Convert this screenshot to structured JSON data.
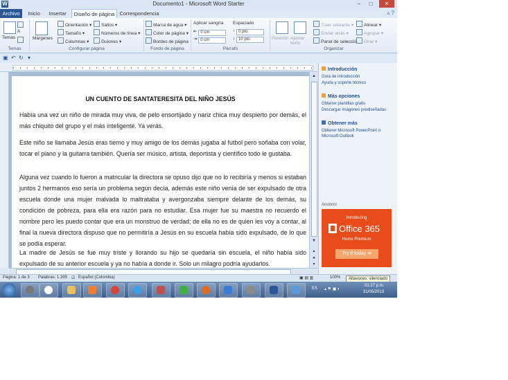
{
  "window": {
    "title": "Documento1 - Microsoft Word Starter",
    "app_icon": "W"
  },
  "tabs": [
    {
      "label": "Archivo"
    },
    {
      "label": "Inicio"
    },
    {
      "label": "Insertar"
    },
    {
      "label": "Diseño de página"
    },
    {
      "label": "Correspondencia"
    }
  ],
  "ribbon": {
    "temas": {
      "label": "Temas",
      "group": "Temas"
    },
    "configurar": {
      "margenes": "Márgenes",
      "orientacion": "Orientación",
      "tamano": "Tamaño",
      "columnas": "Columnas",
      "saltos": "Saltos",
      "numeros_linea": "Números de línea",
      "guiones": "Guiones",
      "group": "Configurar página"
    },
    "fondo": {
      "marca_agua": "Marca de agua",
      "color_pagina": "Color de página",
      "bordes_pagina": "Bordes de página",
      "group": "Fondo de página"
    },
    "parrafo": {
      "aplicar_sangria": "Aplicar sangría",
      "espaciado": "Espaciado",
      "izq": "0 cm",
      "der": "0 cm",
      "antes": "0 pto",
      "despues": "10 pto",
      "group": "Párrafo"
    },
    "organizar": {
      "posicion": "Posición",
      "ajustar_texto": "Ajustar texto",
      "traer_adelante": "Traer adelante",
      "enviar_atras": "Enviar atrás",
      "panel_seleccion": "Panel de selección",
      "alinear": "Alinear",
      "agrupar": "Agrupar",
      "girar": "Girar",
      "group": "Organizar"
    }
  },
  "document": {
    "title": "UN CUENTO DE SANTATERESITA DEL NIÑO JESÚS",
    "paragraphs": [
      "Había una vez un niño de mirada muy viva, de pelo ensortijado y nariz chica muy despierto por demás, el más chiquito del grupo y el más inteligente. Ya verás.",
      "Este niño se llamaba Jesús eras tierno y muy amigo de los demás jugaba al futbol pero soñaba con volar, tocar el piano y la guitarra también. Quería ser músico, artista, deportista y científico todo le gustaba.",
      "Alguna vez cuando lo fueron a matricular la directora se opuso dijo que no lo recibiría y menos si estaban juntos 2 hermanos eso sería un problema según decía, además este niño venía de ser expulsado de otra escuela donde una mujer malvada lo maltrataba y avergonzaba siempre delante de los demás, su condición de pobreza, para ella era razón para no estudiar. Esa mujer fue su maestra no recuerdo el nombre pero les puedo contar que era un monstruo de verdad; de ella no es de quien les voy a contar, al final la nueva directora dispuso que no permitiría a Jesús en su escuela había sido expulsado, de lo que se podía esperar.",
      "La madre de Jesús se fue muy triste y llorando su hijo se quedaría sin escuela, el niño había sido expulsado de su anterior escuela y ya no había a donde ir. Solo un milagro podría ayudarlos."
    ]
  },
  "task_pane": {
    "sections": [
      {
        "title": "Introducción",
        "links": [
          "Guía de introducción",
          "Ayuda y soporte técnico"
        ]
      },
      {
        "title": "Más opciones",
        "links": [
          "Obtener plantillas gratis",
          "Descargar imágenes prediseñadas"
        ]
      },
      {
        "title": "Obtener más",
        "links": [
          "Obtener Microsoft PowerPoint o",
          "Microsoft Outlook"
        ]
      }
    ],
    "ad_label": "Anuncio",
    "ad": {
      "intro": "Introducing",
      "product": "Office 365",
      "edition": "Home Premium",
      "cta": "Try it today"
    }
  },
  "status_bar": {
    "page": "Página: 1 de 3",
    "words": "Palabras: 1.395",
    "language": "Español (Colombia)",
    "zoom": "100%",
    "tooltip": "Altavoces: silenciado"
  },
  "taskbar": {
    "language": "ES",
    "time": "01:27 p.m.",
    "date": "31/05/2013"
  },
  "colors": {
    "word_blue": "#2b5797",
    "ribbon_bg": "#dfe9f5",
    "ad_orange": "#e84c1a"
  }
}
